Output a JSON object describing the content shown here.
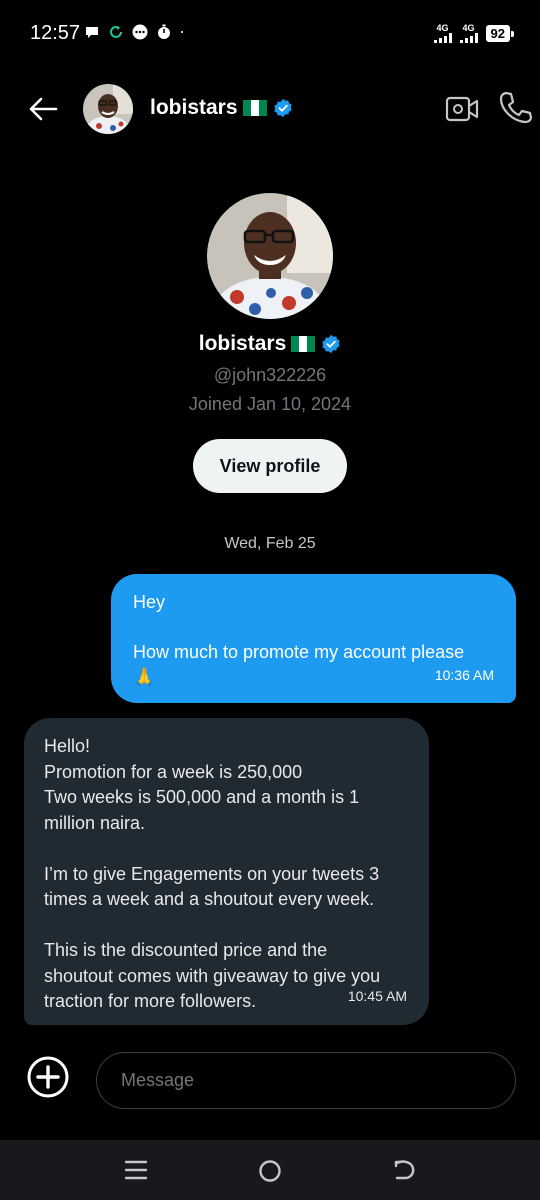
{
  "status_bar": {
    "time": "12:57",
    "network_1": "4G",
    "network_2": "4G",
    "battery": "92",
    "icons": [
      "chat-bubble-icon",
      "sync-icon",
      "more-dots-icon",
      "timer-icon",
      "dot-icon"
    ]
  },
  "header": {
    "name": "lobistars",
    "flag": "nigeria-flag-icon",
    "verified": true
  },
  "profile": {
    "name": "lobistars",
    "handle": "@john322226",
    "joined": "Joined Jan 10, 2024",
    "view_profile_label": "View profile"
  },
  "conversation": {
    "date_separator": "Wed, Feb 25",
    "outgoing": {
      "line1": "Hey",
      "line2": "How much to promote my account please",
      "emoji": "🙏",
      "time": "10:36 AM"
    },
    "incoming": {
      "line1": "Hello!",
      "line2": "Promotion for a week is 250,000",
      "line3": "Two weeks is 500,000 and a month is 1",
      "line4": "million naira.",
      "line5": "I’m to give Engagements on your tweets 3",
      "line6": "times a week and a shoutout every week.",
      "line7": "This is the discounted price and the",
      "line8": "shoutout comes with giveaway to give you",
      "line9": "traction for more followers.",
      "time": "10:45 AM"
    }
  },
  "composer": {
    "placeholder": "Message"
  },
  "colors": {
    "accent": "#1d9bf0",
    "incoming_bubble": "#202a33",
    "background": "#000000",
    "verified": "#1d9bf0",
    "flag_green": "#008751"
  }
}
